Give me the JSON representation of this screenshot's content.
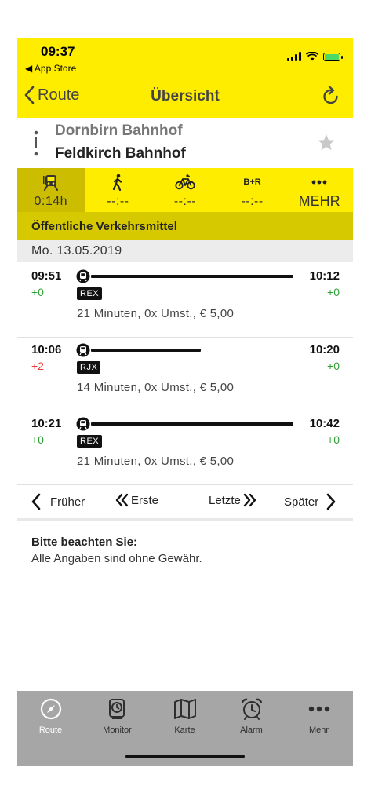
{
  "status": {
    "time": "09:37",
    "back_app": "◀ App Store"
  },
  "nav": {
    "back_label": "Route",
    "title": "Übersicht"
  },
  "route": {
    "from": "Dornbirn Bahnhof",
    "to": "Feldkirch Bahnhof"
  },
  "modes": [
    {
      "name": "public-transport",
      "icon": "train-icon",
      "value": "0:14h",
      "active": true
    },
    {
      "name": "walk",
      "icon": "walk-icon",
      "value": "--:--"
    },
    {
      "name": "bike",
      "icon": "bike-icon",
      "value": "--:--"
    },
    {
      "name": "bike-and-ride",
      "icon": "bike-ride-icon",
      "icon_text": "B+R",
      "value": "--:--"
    },
    {
      "name": "more",
      "icon": "more-dots-icon",
      "label": "MEHR"
    }
  ],
  "section_title": "Öffentliche Verkehrsmittel",
  "date": "Mo. 13.05.2019",
  "connections": [
    {
      "dep": "09:51",
      "dep_delay": "+0",
      "arr": "10:12",
      "arr_delay": "+0",
      "train": "REX",
      "summary": "21  Minuten,  0x Umst.,  € 5,00"
    },
    {
      "dep": "10:06",
      "dep_delay": "+2",
      "arr": "10:20",
      "arr_delay": "+0",
      "train": "RJX",
      "summary": "14  Minuten,  0x Umst.,  € 5,00"
    },
    {
      "dep": "10:21",
      "dep_delay": "+0",
      "arr": "10:42",
      "arr_delay": "+0",
      "train": "REX",
      "summary": "21  Minuten,  0x Umst.,  € 5,00"
    }
  ],
  "pager": {
    "earlier": "Früher",
    "first": "Erste",
    "last": "Letzte",
    "later": "Später"
  },
  "notice": {
    "title": "Bitte beachten Sie:",
    "text": "Alle Angaben sind ohne Gewähr."
  },
  "tabs": [
    {
      "label": "Route",
      "icon": "compass-icon",
      "active": true
    },
    {
      "label": "Monitor",
      "icon": "monitor-clock-icon"
    },
    {
      "label": "Karte",
      "icon": "map-icon"
    },
    {
      "label": "Alarm",
      "icon": "alarm-clock-icon"
    },
    {
      "label": "Mehr",
      "icon": "more-dots-icon"
    }
  ],
  "colors": {
    "header_yellow": "#ffed00",
    "section_yellow": "#d7c900",
    "delay_ok": "#2e9e35",
    "delay_late": "#e53935",
    "tabbar": "#a6a6a6"
  }
}
